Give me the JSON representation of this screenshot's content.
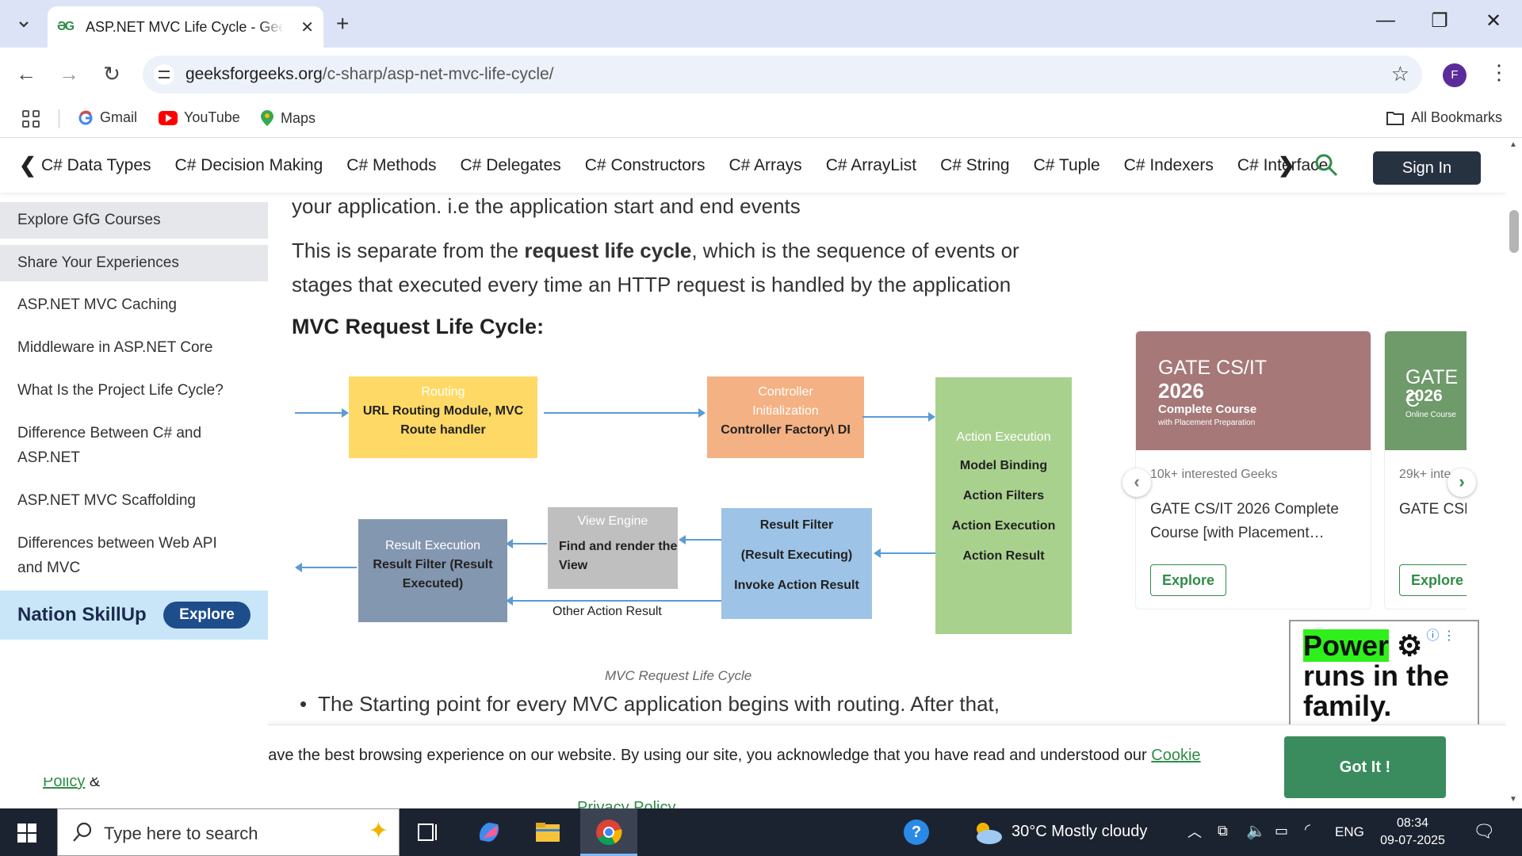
{
  "browser": {
    "tab_title": "ASP.NET MVC Life Cycle - GeeksforGeeks",
    "url_domain": "geeksforgeeks.org",
    "url_path": "/c-sharp/asp-net-mvc-life-cycle/",
    "profile_initial": "F",
    "bookmarks": [
      "Gmail",
      "YouTube",
      "Maps"
    ],
    "all_bookmarks": "All Bookmarks"
  },
  "topnav": {
    "links": [
      "C# Data Types",
      "C# Decision Making",
      "C# Methods",
      "C# Delegates",
      "C# Constructors",
      "C# Arrays",
      "C# ArrayList",
      "C# String",
      "C# Tuple",
      "C# Indexers",
      "C# Interface"
    ],
    "sign_in": "Sign In"
  },
  "sidebar": {
    "items": [
      "Explore GfG Courses",
      "Share Your Experiences",
      "ASP.NET MVC Caching",
      "Middleware in ASP.NET Core",
      "What Is the Project Life Cycle?",
      "Difference Between C# and ASP.NET",
      "ASP.NET MVC Scaffolding",
      "Differences between Web API and MVC"
    ],
    "nation_label": "Nation SkillUp",
    "nation_button": "Explore"
  },
  "article": {
    "para1": "your application. i.e  the application start and end events",
    "para2_a": "This is separate from the ",
    "para2_b": "request life cycle",
    "para2_c": ", which is the sequence of events or",
    "para2_d": "stages that executed every time an HTTP request is handled by the application",
    "heading": "MVC Request Life Cycle:",
    "caption": "MVC Request Life Cycle",
    "bullet": "The Starting point for every MVC application begins with routing. After that,"
  },
  "diagram": {
    "routing": {
      "sub": "Routing",
      "main": "URL Routing Module, MVC Route handler"
    },
    "controller": {
      "sub": "Controller Initialization",
      "main": "Controller Factory\\ DI"
    },
    "action": {
      "sub": "Action Execution",
      "items": [
        "Model Binding",
        "Action Filters",
        "Action Execution",
        "Action Result"
      ]
    },
    "result_filter": {
      "items": [
        "Result Filter",
        "(Result Executing)",
        "Invoke Action Result"
      ]
    },
    "view_engine": {
      "sub": "View Engine",
      "main": "Find and render the View"
    },
    "result_exec": {
      "sub": "Result Execution",
      "main": "Result Filter (Result Executed)"
    },
    "other_result": "Other Action Result",
    "colors": {
      "routing": "#ffd966",
      "controller": "#f4b183",
      "action": "#a9d18e",
      "result_filter": "#9dc3e6",
      "view_engine": "#bfbfbf",
      "result_exec": "#8497b0"
    }
  },
  "courses": [
    {
      "img_title1": "GATE CS/IT",
      "img_title2": "2026",
      "img_sub": "Complete Course",
      "img_tag": "with Placement Preparation",
      "meta": "10k+ interested Geeks",
      "title": "GATE CS/IT 2026 Complete Course [with Placement…",
      "button": "Explore"
    },
    {
      "img_title1": "GATE C",
      "img_title2": "2026",
      "img_sub": "Online Course",
      "img_tag": "",
      "meta": "29k+ inte",
      "title": "GATE CSE [Live Wee",
      "button": "Explore"
    }
  ],
  "ad": {
    "line1": "Power",
    "line2": "runs in the",
    "line3": "family."
  },
  "cookie": {
    "text": "We use cookies to ensure you have the best browsing experience on our website. By using our site, you acknowledge that you have read and understood our ",
    "cookie_link": "Cookie Policy",
    "amp": " & ",
    "privacy_link": "Privacy Policy",
    "button": "Got It !"
  },
  "taskbar": {
    "search_placeholder": "Type here to search",
    "weather": "30°C  Mostly cloudy",
    "lang": "ENG",
    "time": "08:34",
    "date": "09-07-2025"
  }
}
